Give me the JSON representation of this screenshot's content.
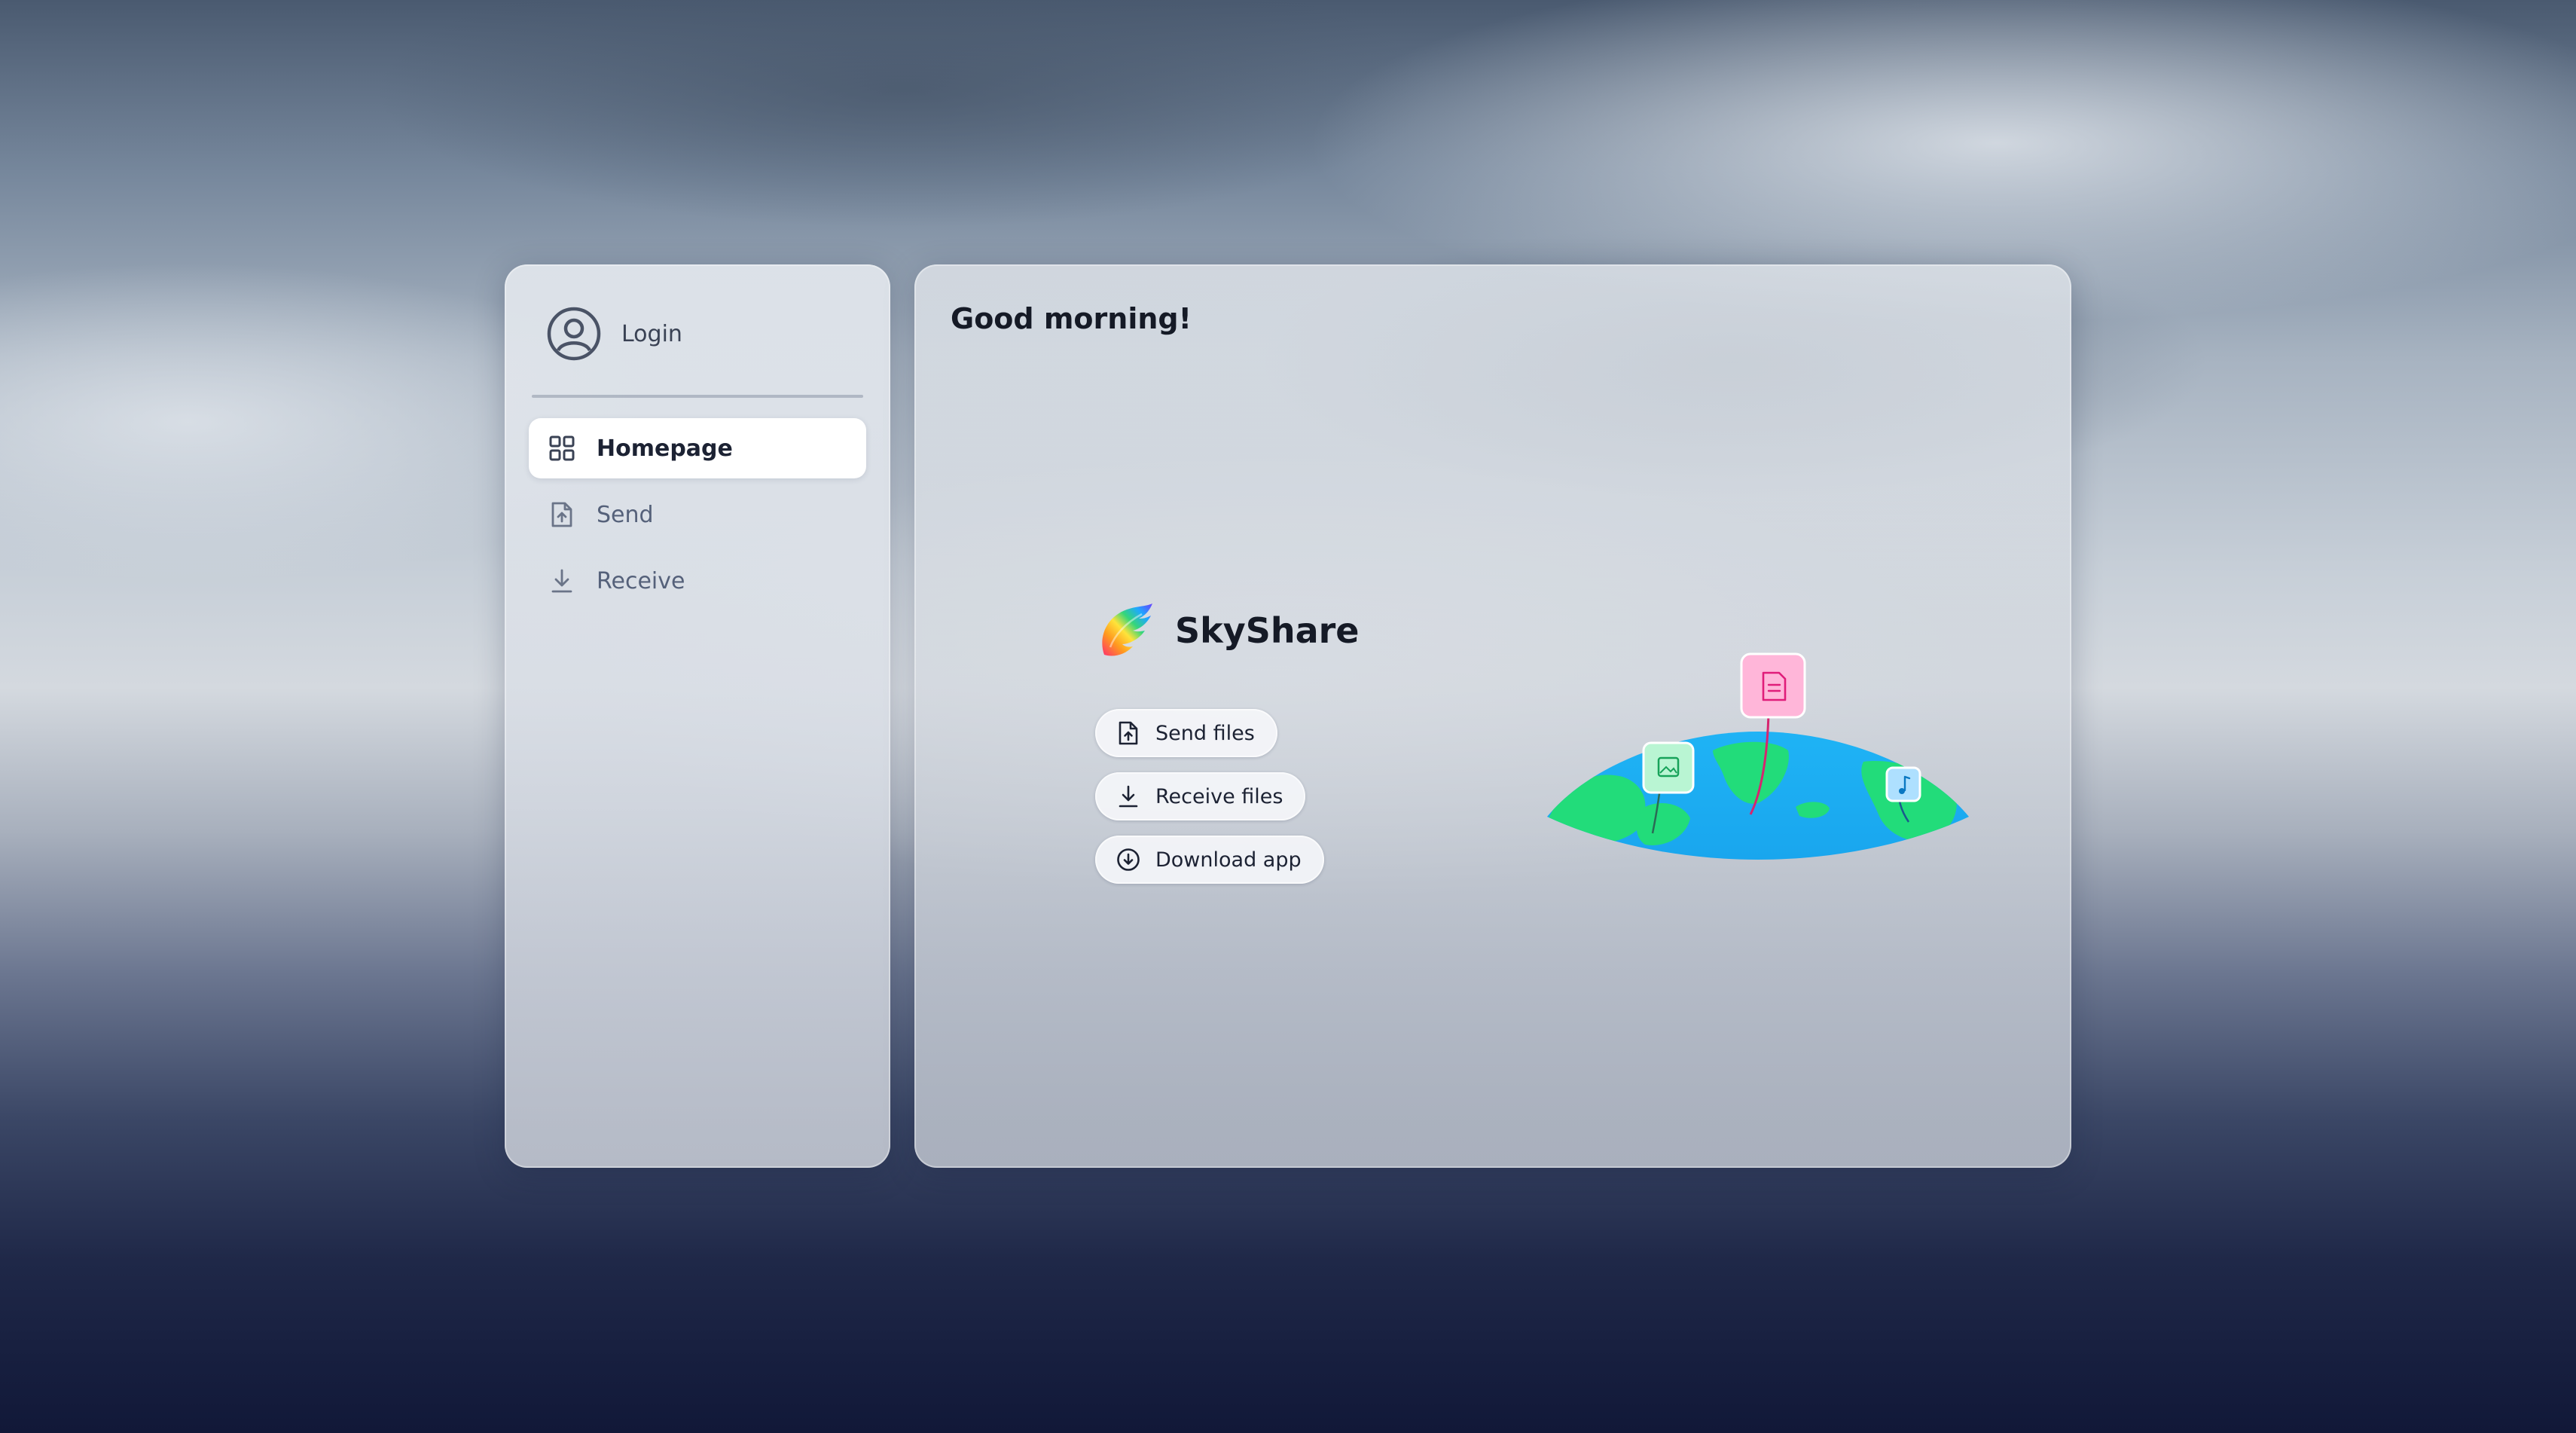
{
  "sidebar": {
    "login_label": "Login",
    "items": [
      {
        "label": "Homepage",
        "icon": "grid-icon",
        "active": true
      },
      {
        "label": "Send",
        "icon": "file-upload-icon",
        "active": false
      },
      {
        "label": "Receive",
        "icon": "download-icon",
        "active": false
      }
    ]
  },
  "main": {
    "greeting": "Good morning!",
    "brand_name": "SkyShare",
    "actions": [
      {
        "label": "Send files",
        "icon": "file-upload-icon"
      },
      {
        "label": "Receive files",
        "icon": "download-icon"
      },
      {
        "label": "Download app",
        "icon": "circle-download-icon"
      }
    ]
  },
  "colors": {
    "accent_pink": "#ff4fa3",
    "accent_green": "#2fd98a",
    "accent_blue": "#1ba7f2",
    "text_primary": "#151a26"
  }
}
